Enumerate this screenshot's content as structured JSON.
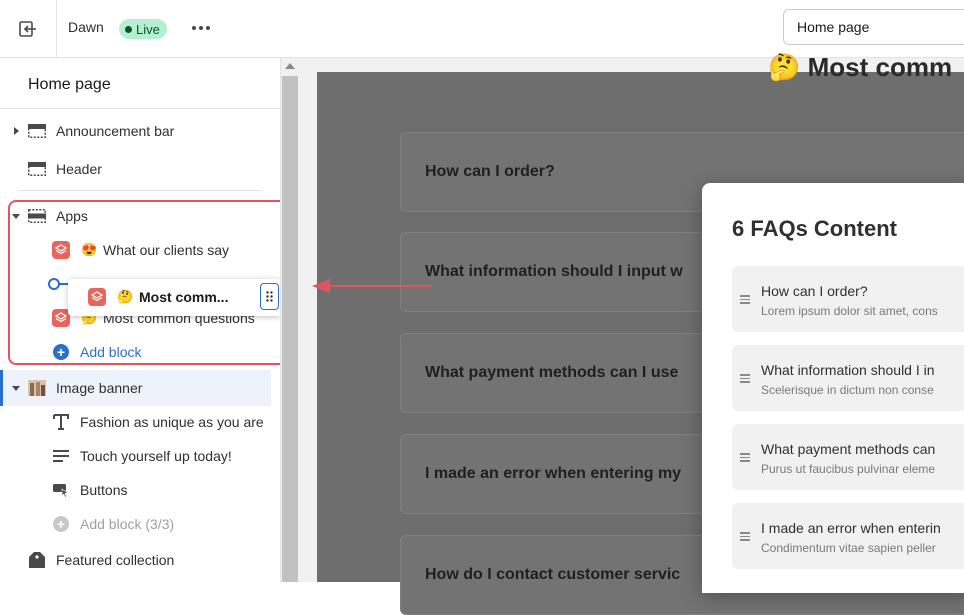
{
  "topbar": {
    "theme_name": "Dawn",
    "status_badge": "Live",
    "page_selector": "Home page"
  },
  "sidebar": {
    "title": "Home page",
    "sections": {
      "announcement_bar": "Announcement bar",
      "header": "Header",
      "apps": "Apps",
      "image_banner": "Image banner",
      "featured_collection": "Featured collection"
    },
    "app_blocks": [
      {
        "emoji": "😍",
        "label": "What our clients say"
      },
      {
        "emoji": "🤔",
        "label": "Most common questions"
      }
    ],
    "dragging_block": {
      "emoji": "🤔",
      "label": "Most comm..."
    },
    "add_block": "Add block",
    "banner_blocks": [
      {
        "label": "Fashion as unique as you are",
        "icon": "text-icon"
      },
      {
        "label": "Touch yourself up today!",
        "icon": "paragraph-icon"
      },
      {
        "label": "Buttons",
        "icon": "buttons-icon"
      }
    ],
    "add_block_banner": "Add block (3/3)"
  },
  "preview": {
    "section_heading_emoji": "🤔",
    "section_heading": "Most comm",
    "faq_questions": [
      "How can I order?",
      "What information should I input w",
      "What payment methods can I use",
      "I made an error when entering my",
      "How do I contact customer servic"
    ]
  },
  "popover": {
    "title": "6 FAQs Content",
    "items": [
      {
        "question": "How can I order?",
        "answer": "Lorem ipsum dolor sit amet, cons"
      },
      {
        "question": "What information should I in",
        "answer": "Scelerisque in dictum non conse"
      },
      {
        "question": "What payment methods can",
        "answer": "Purus ut faucibus pulvinar eleme"
      },
      {
        "question": "I made an error when enterin",
        "answer": "Condimentum vitae sapien peller"
      }
    ]
  },
  "colors": {
    "accent_blue": "#2c6ecb",
    "highlight_red": "#e05560",
    "live_green_bg": "#b4f0cf",
    "app_icon_red": "#e8655d"
  }
}
